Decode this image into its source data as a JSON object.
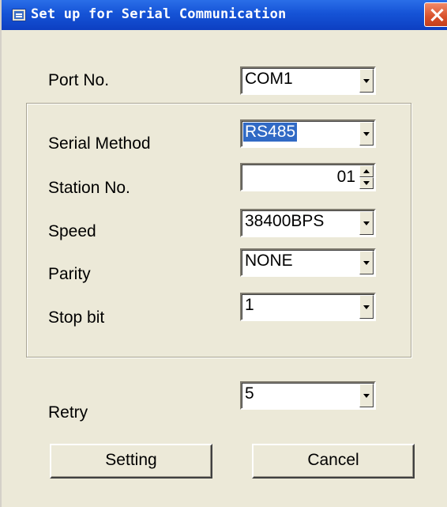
{
  "window": {
    "title": "Set up for Serial Communication"
  },
  "port": {
    "label": "Port No.",
    "value": "COM1"
  },
  "serial_method": {
    "label": "Serial Method",
    "value": "RS485"
  },
  "station": {
    "label": "Station No.",
    "value": "01"
  },
  "speed": {
    "label": "Speed",
    "value": "38400BPS"
  },
  "parity": {
    "label": "Parity",
    "value": "NONE"
  },
  "stop_bit": {
    "label": "Stop bit",
    "value": "1"
  },
  "retry": {
    "label": "Retry",
    "value": "5"
  },
  "buttons": {
    "setting": "Setting",
    "cancel": "Cancel"
  }
}
